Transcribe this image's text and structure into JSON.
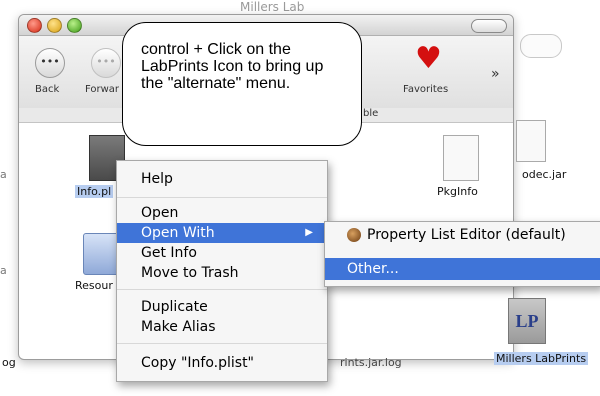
{
  "background": {
    "window_title": "Millers Lab",
    "toolbar": {
      "back_label": "Back",
      "forward_label": "Forwar",
      "favorites_label": "Favorites",
      "more_glyph": "»"
    },
    "path_fragment": "ble",
    "files": [
      {
        "label": "Info.pl",
        "selected": true
      },
      {
        "label": "PkgInfo"
      },
      {
        "label": "Resour"
      },
      {
        "label": "odec.jar"
      },
      {
        "label": "Millers LabPrints"
      }
    ],
    "edge_labels": {
      "left_top": "a",
      "left_mid": "a",
      "left_bottom": "og",
      "bottom_mid": "rints.jar.log",
      "icon_text": "LP"
    }
  },
  "callout": {
    "text": "control + Click on the LabPrints Icon to bring up the \"alternate\" menu."
  },
  "context_menu": {
    "items": [
      "Help",
      "Open",
      "Open With",
      "Get Info",
      "Move to Trash",
      "Duplicate",
      "Make Alias",
      "Copy \"Info.plist\""
    ],
    "highlighted": "Open With",
    "submenu_arrow": "▶"
  },
  "submenu": {
    "items": [
      "Property List Editor (default)",
      "Other..."
    ],
    "highlighted": "Other..."
  },
  "colors": {
    "highlight": "#3f74d8",
    "menu_bg": "#f6f6f6",
    "favorites_heart": "#d41010"
  }
}
